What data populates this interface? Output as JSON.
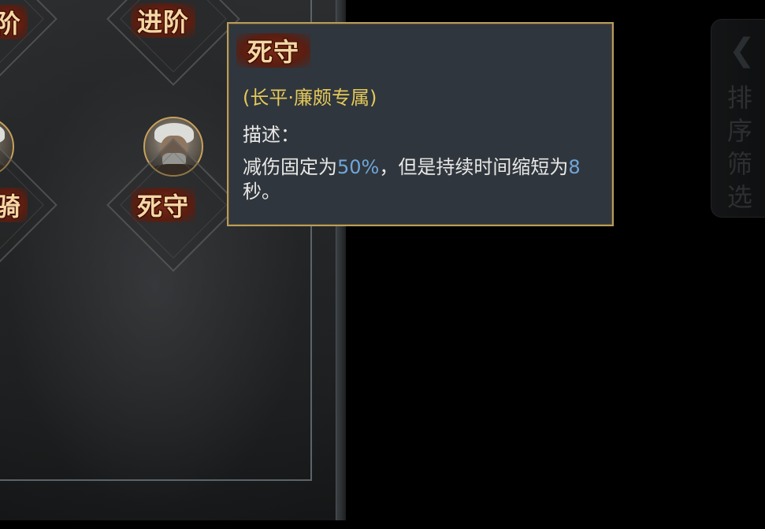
{
  "panel": {
    "cells": [
      {
        "id": "top-left",
        "label": "阶"
      },
      {
        "id": "top-right",
        "label": "进阶"
      },
      {
        "id": "mid-left",
        "label": "骑"
      },
      {
        "id": "mid-right",
        "label": "死守"
      }
    ]
  },
  "tooltip": {
    "title": "死守",
    "subtitle": "(长平·廉颇专属)",
    "desc_label": "描述：",
    "desc_part1": "减伤固定为",
    "desc_value1": "50%",
    "desc_part2": "，但是持续时间缩短为",
    "desc_value2": "8",
    "desc_part3": "秒。",
    "highlight_color": "#6fa6da",
    "subtitle_color": "#e4c85a",
    "border_color": "#b89d5f"
  },
  "sort_filter": {
    "chevron_icon": "chevron-left-icon",
    "label": "排序筛选"
  }
}
